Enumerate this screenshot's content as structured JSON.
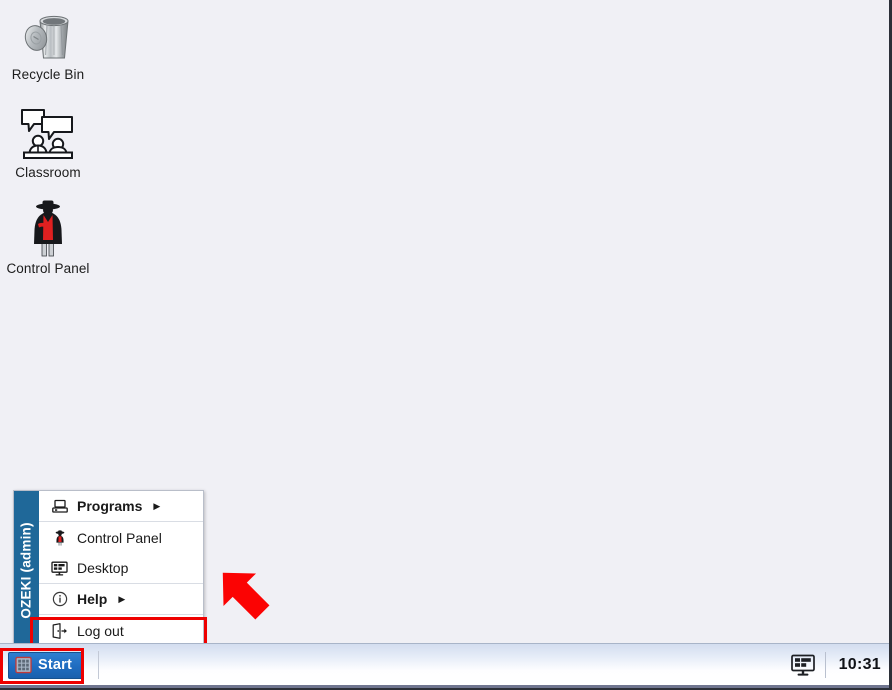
{
  "desktop": {
    "background_color": "#f0f0f5",
    "icons": [
      {
        "id": "recycle-bin",
        "label": "Recycle Bin",
        "icon": "recycle-bin-icon"
      },
      {
        "id": "classroom",
        "label": "Classroom",
        "icon": "classroom-icon"
      },
      {
        "id": "control-panel",
        "label": "Control Panel",
        "icon": "control-panel-icon"
      }
    ]
  },
  "taskbar": {
    "start_button": {
      "label": "Start",
      "icon": "windows-grid-icon",
      "highlighted": true
    },
    "tray": {
      "display_icon": "monitor-icon",
      "clock": "10:31"
    }
  },
  "start_menu": {
    "sidebar_label": "OZEKI (admin)",
    "accent_color": "#1f6899",
    "items": [
      {
        "label": "Programs",
        "icon": "programs-icon",
        "has_submenu": true,
        "submenu_arrow": "▶",
        "bold": true
      },
      {
        "label": "Control Panel",
        "icon": "control-panel-person-icon",
        "has_submenu": false,
        "bold": false
      },
      {
        "label": "Desktop",
        "icon": "monitor-icon",
        "has_submenu": false,
        "bold": false
      },
      {
        "label": "Help",
        "icon": "info-circle-icon",
        "has_submenu": true,
        "submenu_arrow": "▶",
        "bold": true
      },
      {
        "label": "Log out",
        "icon": "logout-door-icon",
        "has_submenu": false,
        "bold": false,
        "highlighted": true
      }
    ]
  },
  "annotations": {
    "highlight_color": "#ee0000",
    "arrows": [
      {
        "id": "arrow-to-logout",
        "direction": "down-left",
        "points_at": "Log out"
      },
      {
        "id": "arrow-to-start",
        "direction": "left",
        "points_at": "Start"
      }
    ]
  }
}
